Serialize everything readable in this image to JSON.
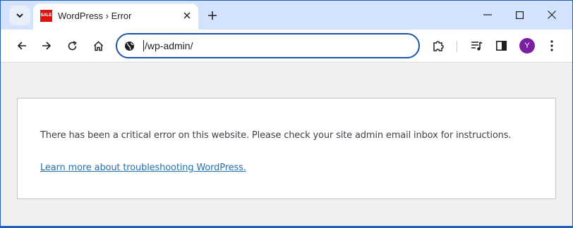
{
  "tab": {
    "favicon_text": "SALE",
    "title": "WordPress › Error"
  },
  "omnibox": {
    "url": "/wp-admin/"
  },
  "profile": {
    "initial": "Y",
    "color": "#7a1fa2"
  },
  "page": {
    "message": "There has been a critical error on this website. Please check your site admin email inbox for instructions.",
    "link_text": "Learn more about troubleshooting WordPress.",
    "link_color": "#2271b1"
  },
  "icons": [
    "tab-search-icon",
    "close-icon",
    "new-tab-icon",
    "minimize-icon",
    "maximize-icon",
    "close-window-icon",
    "back-icon",
    "forward-icon",
    "reload-icon",
    "home-icon",
    "site-info-icon",
    "extensions-icon",
    "media-control-icon",
    "side-panel-icon",
    "menu-icon"
  ]
}
